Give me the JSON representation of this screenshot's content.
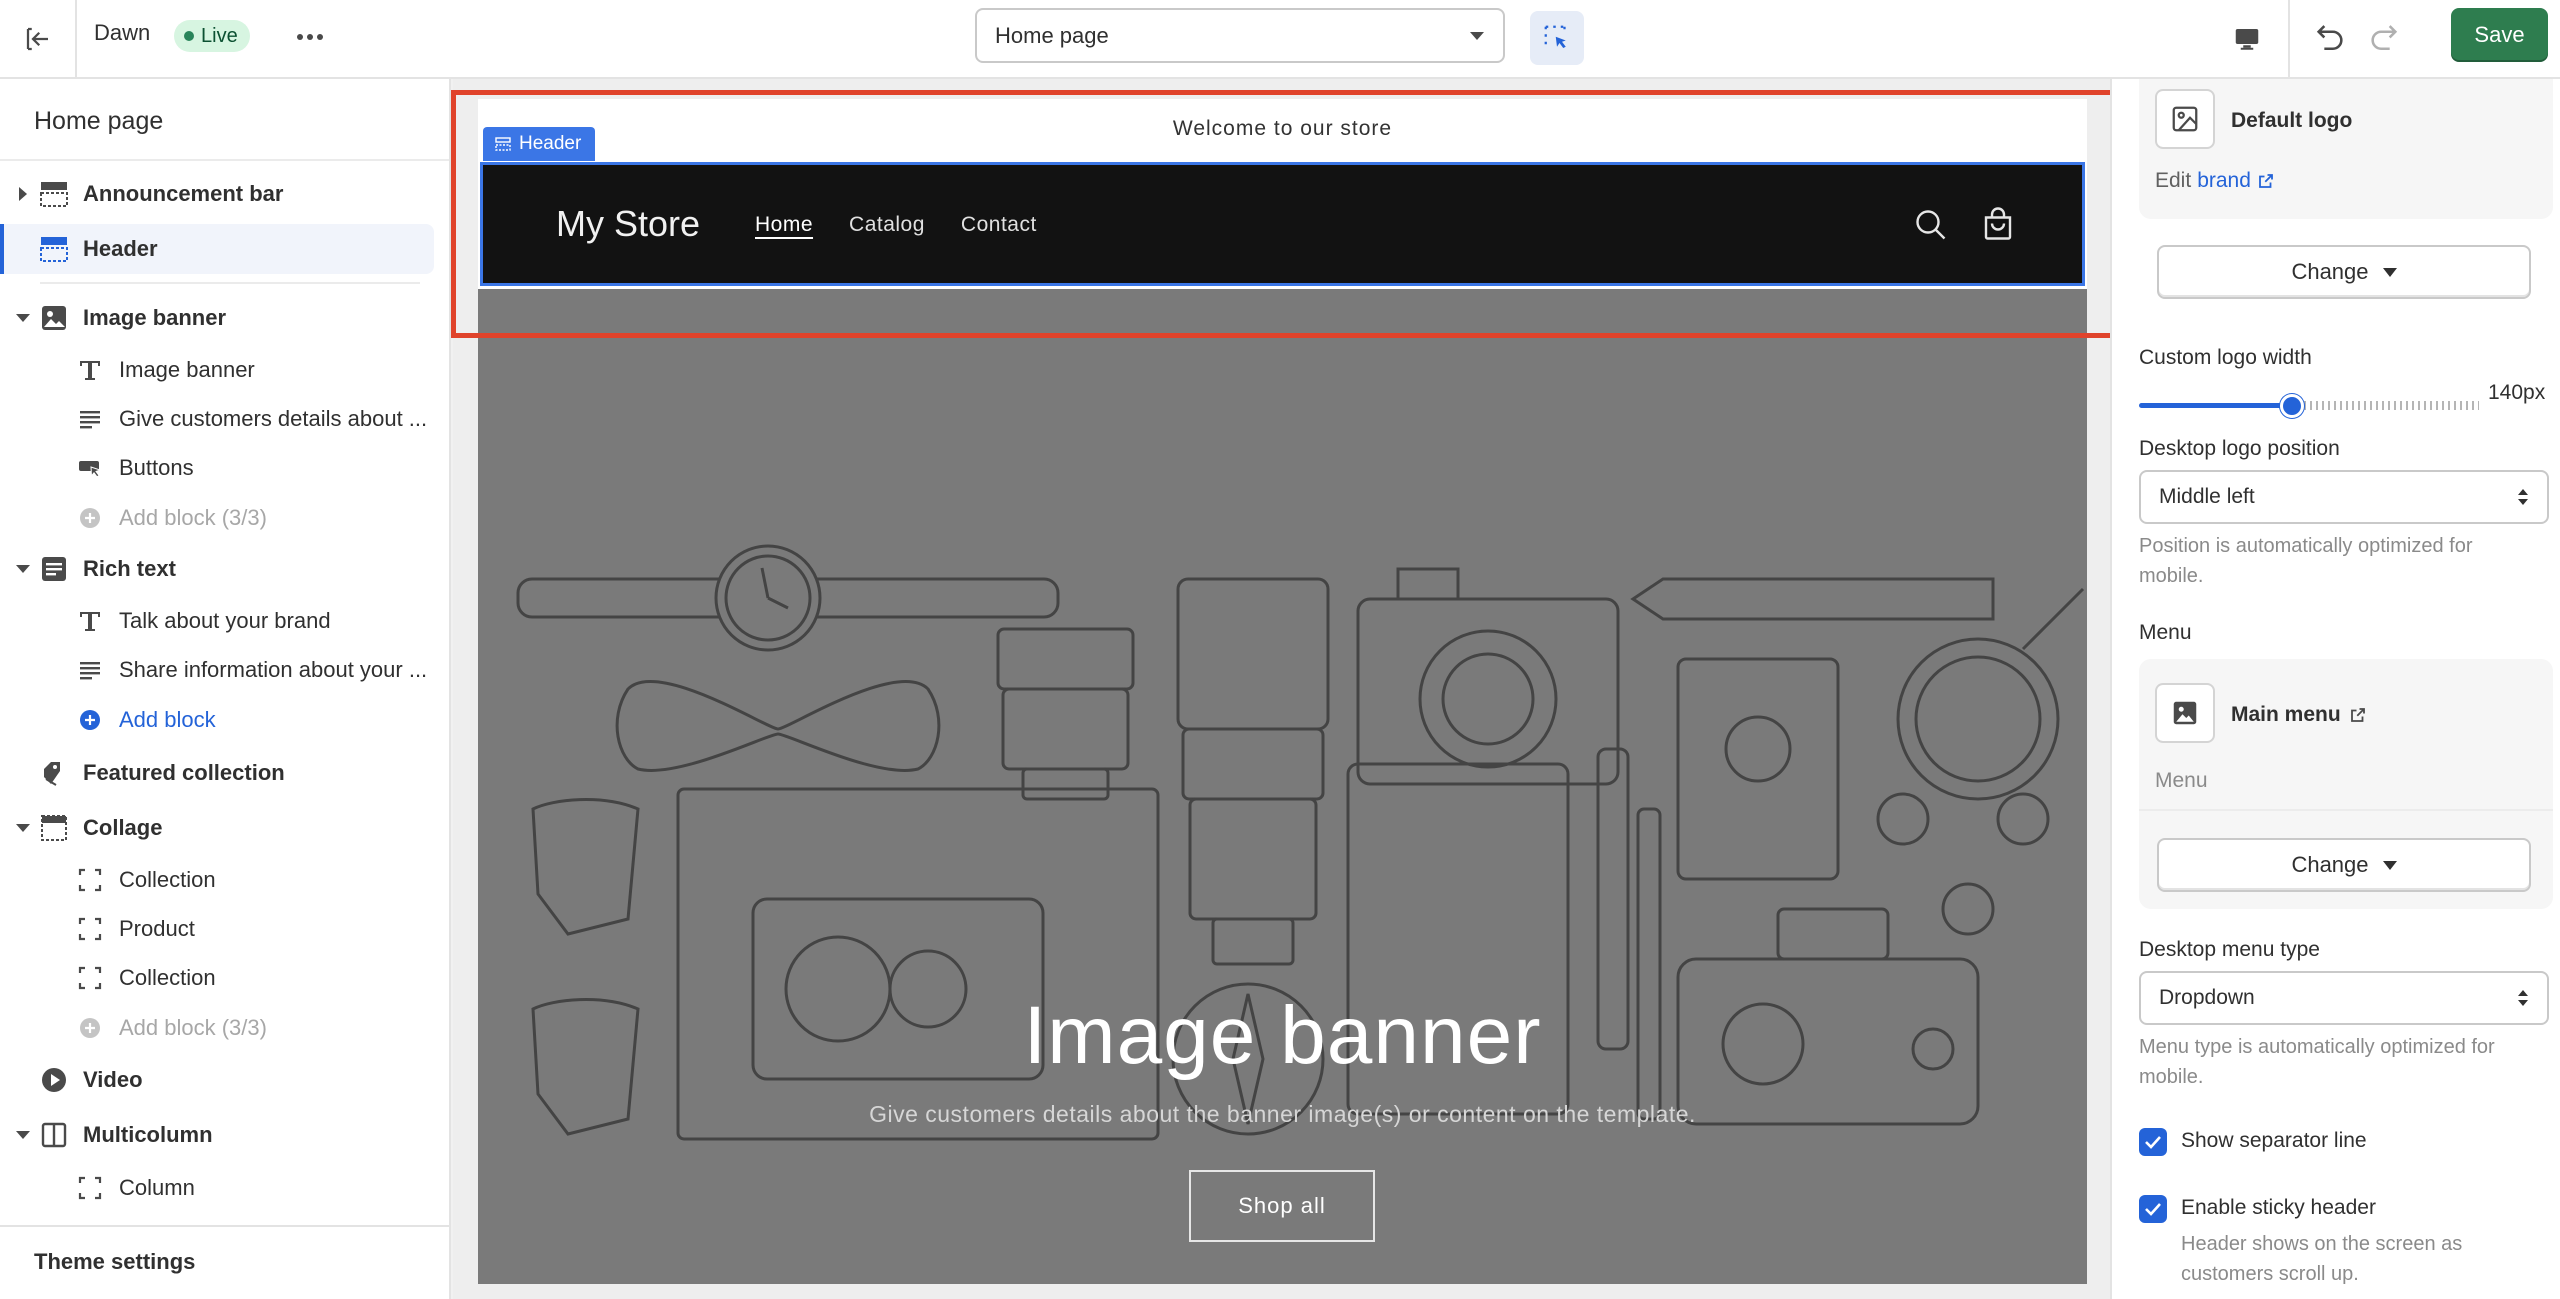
{
  "topbar": {
    "theme_name": "Dawn",
    "live_badge": "Live",
    "page_select": "Home page",
    "save_label": "Save"
  },
  "sidebar": {
    "title": "Home page",
    "items": [
      {
        "label": "Announcement bar",
        "icon": "announcement-bar-icon"
      },
      {
        "label": "Header",
        "icon": "header-icon"
      },
      {
        "label": "Image banner",
        "icon": "image-icon"
      },
      {
        "label": "Image banner",
        "icon": "text-icon"
      },
      {
        "label": "Give customers details about ...",
        "icon": "paragraph-icon"
      },
      {
        "label": "Buttons",
        "icon": "button-icon"
      },
      {
        "label": "Add block (3/3)",
        "icon": "add-circle-icon"
      },
      {
        "label": "Rich text",
        "icon": "rich-text-icon"
      },
      {
        "label": "Talk about your brand",
        "icon": "text-icon"
      },
      {
        "label": "Share information about your ...",
        "icon": "paragraph-icon"
      },
      {
        "label": "Add block",
        "icon": "add-circle-icon"
      },
      {
        "label": "Featured collection",
        "icon": "tag-icon"
      },
      {
        "label": "Collage",
        "icon": "collage-icon"
      },
      {
        "label": "Collection",
        "icon": "dashed-square-icon"
      },
      {
        "label": "Product",
        "icon": "dashed-square-icon"
      },
      {
        "label": "Collection",
        "icon": "dashed-square-icon"
      },
      {
        "label": "Add block (3/3)",
        "icon": "add-circle-icon"
      },
      {
        "label": "Video",
        "icon": "play-icon"
      },
      {
        "label": "Multicolumn",
        "icon": "columns-icon"
      },
      {
        "label": "Column",
        "icon": "dashed-square-icon"
      }
    ],
    "footer": "Theme settings"
  },
  "preview": {
    "announcement": "Welcome to our store",
    "header_tag": "Header",
    "store_name": "My Store",
    "nav": [
      "Home",
      "Catalog",
      "Contact"
    ],
    "banner_title": "Image banner",
    "banner_subtitle": "Give customers details about the banner image(s) or content on the template.",
    "banner_button": "Shop all"
  },
  "panel": {
    "logo_title": "Default logo",
    "edit_prefix": "Edit",
    "edit_link": "brand",
    "change_label": "Change",
    "logo_width_label": "Custom logo width",
    "logo_width_value": "140px",
    "logo_width_fraction": 0.45,
    "logo_position_label": "Desktop logo position",
    "logo_position_value": "Middle left",
    "logo_position_help": "Position is automatically optimized for mobile.",
    "menu_label": "Menu",
    "menu_title": "Main menu",
    "menu_sub": "Menu",
    "menu_change_label": "Change",
    "menu_type_label": "Desktop menu type",
    "menu_type_value": "Dropdown",
    "menu_type_help": "Menu type is automatically optimized for mobile.",
    "separator_label": "Show separator line",
    "sticky_label": "Enable sticky header",
    "sticky_help": "Header shows on the screen as customers scroll up."
  },
  "colors": {
    "accent": "#2463d8",
    "save": "#2e7d4f",
    "highlight_box": "#e0432b",
    "header_outline": "#3b76e6"
  }
}
